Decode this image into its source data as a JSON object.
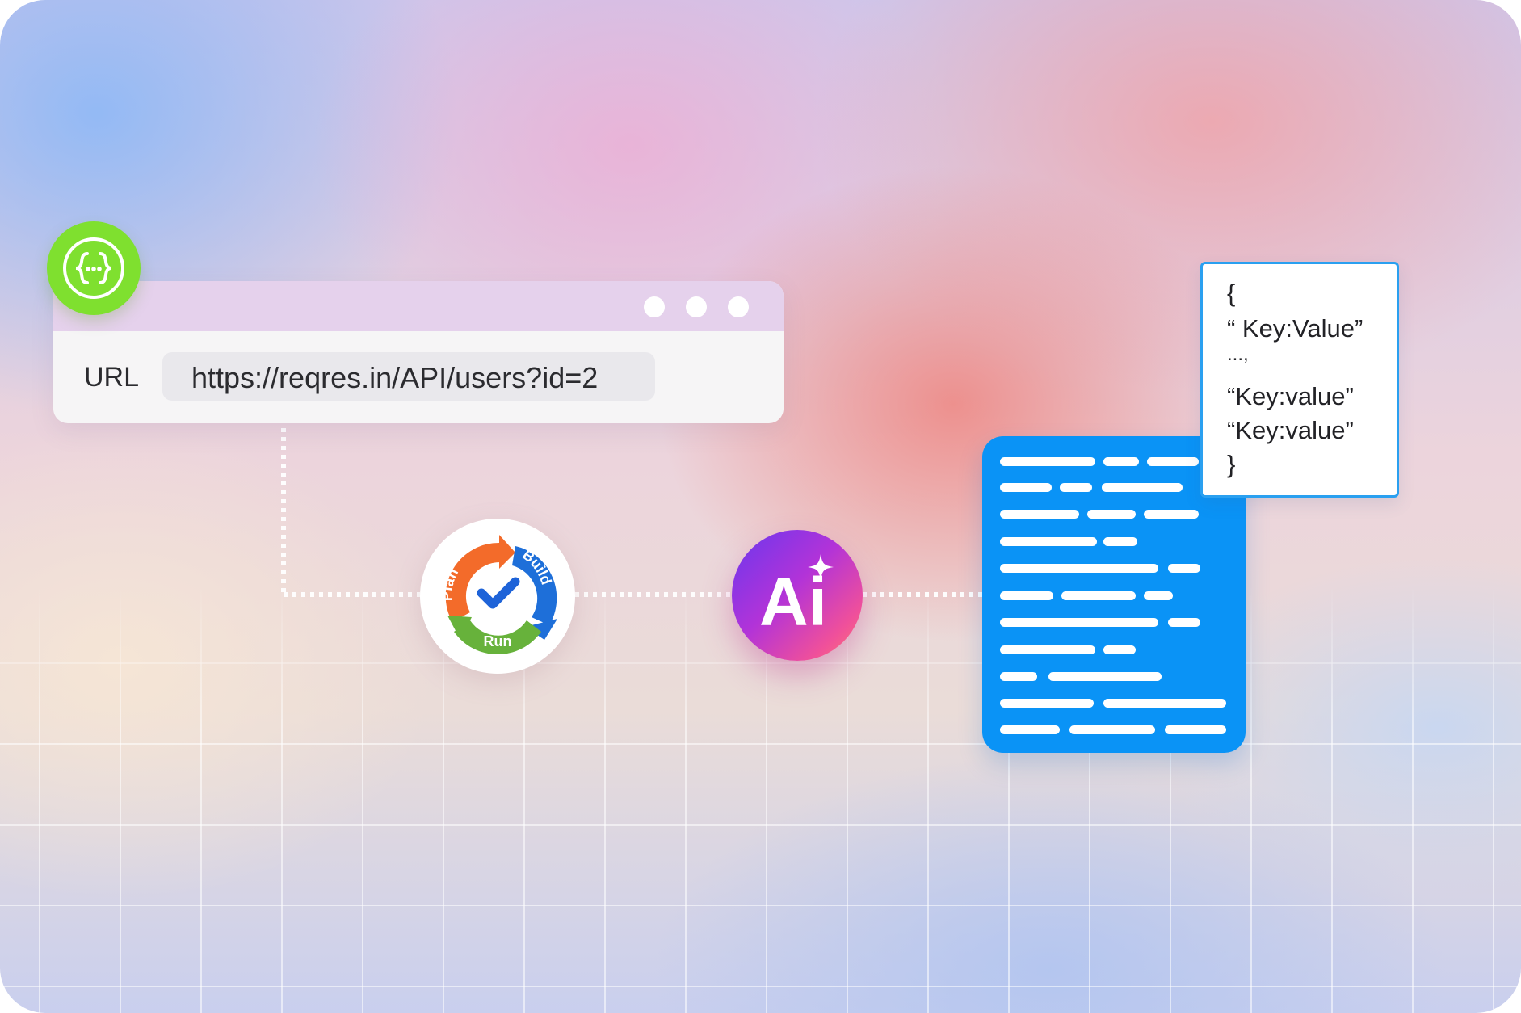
{
  "api_badge": {
    "icon": "api-braces-icon",
    "color": "#7fe02f"
  },
  "browser": {
    "url_label": "URL",
    "url_value": "https://reqres.in/API/users?id=2",
    "window_dots": [
      "window-dot-icon",
      "window-dot-icon",
      "window-dot-icon"
    ]
  },
  "cycle": {
    "plan_label": "Plan",
    "build_label": "Build",
    "run_label": "Run",
    "icon": "checkmark-icon",
    "colors": {
      "plan": "#f36b2a",
      "build": "#1e6fd9",
      "run": "#67b23b",
      "check": "#1e63d8"
    }
  },
  "ai_badge": {
    "label": "Ai",
    "icon": "sparkle-icon"
  },
  "document": {
    "icon": "document-lines-icon",
    "color": "#0a93f6"
  },
  "json_card": {
    "lines": [
      "{",
      "“ Key:Value”",
      "...,",
      "“Key:value”",
      "“Key:value”",
      "}"
    ]
  }
}
